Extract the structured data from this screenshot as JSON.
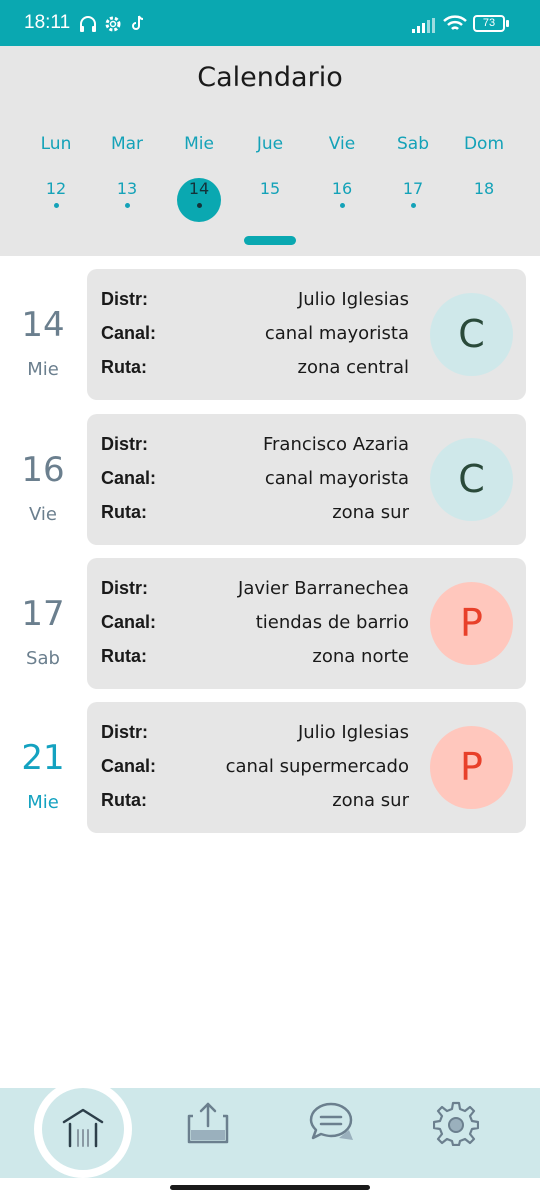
{
  "status": {
    "time": "18:11",
    "battery": "73",
    "colors": {
      "bar": "#0aa8b1",
      "text": "#ffffff"
    },
    "icons": [
      "headphones-icon",
      "settings-icon",
      "tiktok-icon",
      "signal-icon",
      "wifi-icon",
      "battery-icon"
    ]
  },
  "header": {
    "title": "Calendario",
    "days": [
      {
        "name": "Lun",
        "num": "12",
        "has_event": true,
        "selected": false
      },
      {
        "name": "Mar",
        "num": "13",
        "has_event": true,
        "selected": false
      },
      {
        "name": "Mie",
        "num": "14",
        "has_event": true,
        "selected": true
      },
      {
        "name": "Jue",
        "num": "15",
        "has_event": false,
        "selected": false
      },
      {
        "name": "Vie",
        "num": "16",
        "has_event": true,
        "selected": false
      },
      {
        "name": "Sab",
        "num": "17",
        "has_event": true,
        "selected": false
      },
      {
        "name": "Dom",
        "num": "18",
        "has_event": false,
        "selected": false
      }
    ]
  },
  "labels": {
    "distr": "Distr:",
    "canal": "Canal:",
    "ruta": "Ruta:"
  },
  "entries": [
    {
      "day": "14",
      "weekday": "Mie",
      "distr": "Julio Iglesias",
      "canal": "canal mayorista",
      "ruta": "zona central",
      "badge": "C",
      "badge_bg": "#cfe8ea",
      "badge_fg": "#2a4a3a",
      "highlight": false
    },
    {
      "day": "16",
      "weekday": "Vie",
      "distr": "Francisco Azaria",
      "canal": "canal mayorista",
      "ruta": "zona sur",
      "badge": "C",
      "badge_bg": "#cfe8ea",
      "badge_fg": "#2a4a3a",
      "highlight": false
    },
    {
      "day": "17",
      "weekday": "Sab",
      "distr": "Javier Barranechea",
      "canal": "tiendas de barrio",
      "ruta": "zona norte",
      "badge": "P",
      "badge_bg": "#ffc7bd",
      "badge_fg": "#e8402a",
      "highlight": false
    },
    {
      "day": "21",
      "weekday": "Mie",
      "distr": "Julio Iglesias",
      "canal": "canal supermercado",
      "ruta": "zona sur",
      "badge": "P",
      "badge_bg": "#ffc7bd",
      "badge_fg": "#e8402a",
      "highlight": true
    }
  ],
  "nav": {
    "items": [
      "home-icon",
      "upload-icon",
      "chat-icon",
      "settings-icon"
    ],
    "active": "home-icon"
  },
  "theme": {
    "accent": "#0aa8b1",
    "card_bg": "#e6e6e6",
    "nav_bg": "#cfe8ea"
  }
}
